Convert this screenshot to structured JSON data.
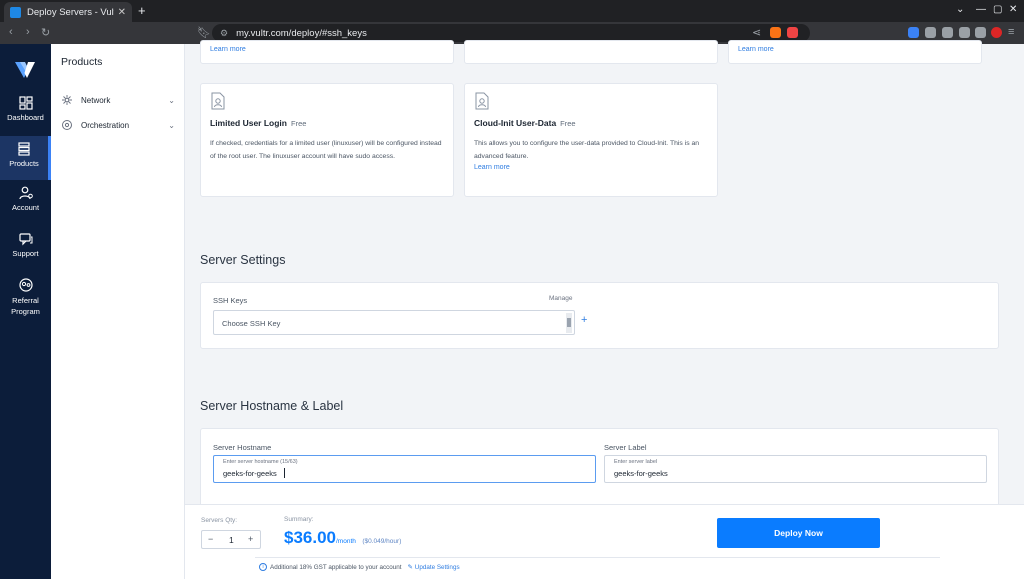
{
  "browser": {
    "tab_title": "Deploy Servers - Vultr.co",
    "url": "my.vultr.com/deploy/#ssh_keys"
  },
  "rail": {
    "items": [
      {
        "label": "Dashboard"
      },
      {
        "label": "Products"
      },
      {
        "label": "Account"
      },
      {
        "label": "Support"
      },
      {
        "label": "Referral Program"
      }
    ]
  },
  "submenu": {
    "header": "Products",
    "items": [
      {
        "label": "Network"
      },
      {
        "label": "Orchestration"
      }
    ]
  },
  "top_cards": {
    "learn_more": "Learn more"
  },
  "cards": [
    {
      "title": "Limited User Login",
      "badge": "Free",
      "description": "If checked, credentials for a limited user (linuxuser) will be configured instead of the root user. The linuxuser account will have sudo access."
    },
    {
      "title": "Cloud-Init User-Data",
      "badge": "Free",
      "description": "This allows you to configure the user-data provided to Cloud-Init. This is an advanced feature.",
      "link": "Learn more"
    }
  ],
  "server_settings": {
    "title": "Server Settings",
    "ssh_label": "SSH Keys",
    "manage": "Manage",
    "ssh_placeholder": "Choose SSH Key",
    "add": "+"
  },
  "hostname_label": {
    "title": "Server Hostname & Label",
    "hostname_label": "Server Hostname",
    "hostname_hint": "Enter server hostname (15/63)",
    "hostname_value": "geeks-for-geeks",
    "label_label": "Server Label",
    "label_hint": "Enter server label",
    "label_value": "geeks-for-geeks"
  },
  "footer": {
    "qty_label": "Servers Qty:",
    "qty_minus": "−",
    "qty_value": "1",
    "qty_plus": "+",
    "summary_label": "Summary:",
    "price": "$36.00",
    "per_month": "/month",
    "per_hour": "($0.049/hour)",
    "deploy": "Deploy Now",
    "gst_note": "Additional 18% GST applicable to your account",
    "update_settings": "Update Settings"
  },
  "colors": {
    "accent": "#0a7cff",
    "rail": "#0c1d3a",
    "link": "#2f7de1"
  }
}
